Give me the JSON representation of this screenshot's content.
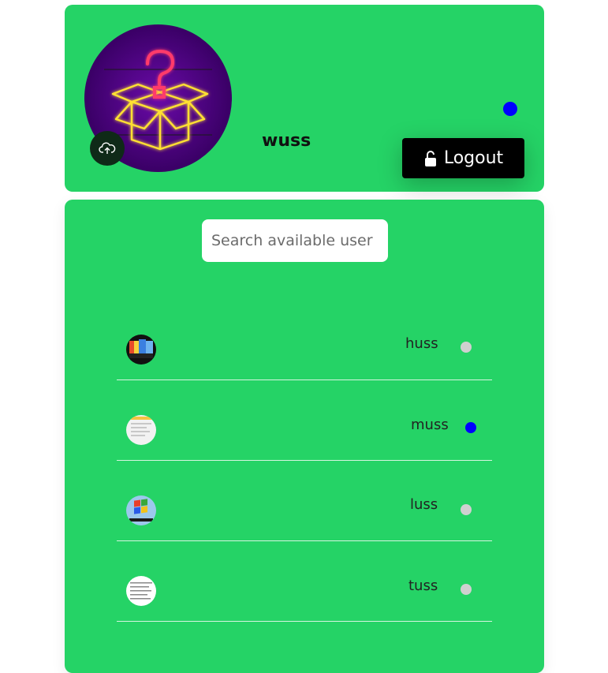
{
  "profile": {
    "name": "wuss",
    "status_color": "#0000ff",
    "logout_label": "Logout",
    "avatar_icon": "question-box-icon",
    "upload_icon": "cloud-upload-icon"
  },
  "search": {
    "placeholder": "Search available user"
  },
  "users": [
    {
      "name": "huss",
      "status_color": "#d0d0d0",
      "avatar": "avatar-image"
    },
    {
      "name": "muss",
      "status_color": "#0000ff",
      "avatar": "avatar-image"
    },
    {
      "name": "luss",
      "status_color": "#d0d0d0",
      "avatar": "windows-logo-avatar"
    },
    {
      "name": "tuss",
      "status_color": "#d0d0d0",
      "avatar": "document-avatar"
    }
  ],
  "colors": {
    "card_bg": "#25d366",
    "online": "#0000ff",
    "offline": "#d0d0d0"
  }
}
